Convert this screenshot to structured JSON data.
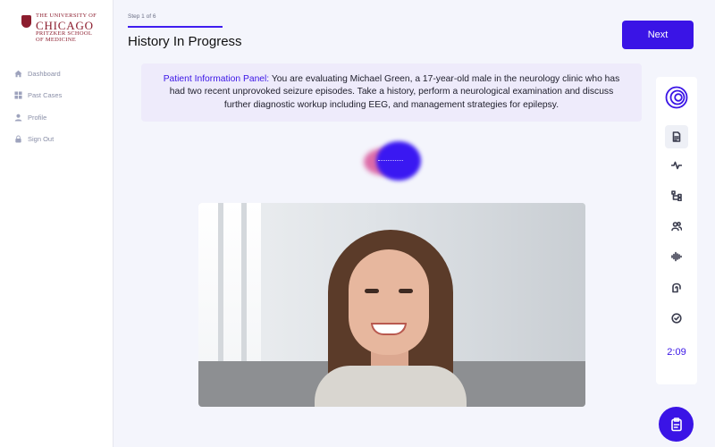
{
  "logo": {
    "line1": "THE UNIVERSITY OF",
    "line2": "CHICAGO",
    "line3": "PRITZKER SCHOOL",
    "line4": "OF MEDICINE"
  },
  "sidebar": {
    "items": [
      {
        "label": "Dashboard",
        "icon": "home-icon"
      },
      {
        "label": "Past Cases",
        "icon": "grid-icon"
      },
      {
        "label": "Profile",
        "icon": "user-icon"
      },
      {
        "label": "Sign Out",
        "icon": "lock-icon"
      }
    ]
  },
  "header": {
    "step": "Step 1 of 6",
    "title": "History In Progress",
    "next_label": "Next"
  },
  "info_panel": {
    "label": "Patient Information Panel:",
    "text": "You are evaluating Michael Green, a 17-year-old male in the neurology clinic who has had two recent unprovoked seizure episodes. Take a history, perform a neurological examination and discuss further diagnostic workup including EEG, and management strategies for epilepsy."
  },
  "toolbar": {
    "icons": [
      "spiral-logo-icon",
      "document-scan-icon",
      "heart-rate-icon",
      "flow-chart-icon",
      "users-icon",
      "audio-wave-icon",
      "hand-icon",
      "check-circle-icon"
    ],
    "timer": "2:09"
  },
  "fab": {
    "icon": "clipboard-icon"
  },
  "colors": {
    "accent": "#3a14e6",
    "brand": "#8c1d2e",
    "panel_bg": "#eeebfb"
  }
}
